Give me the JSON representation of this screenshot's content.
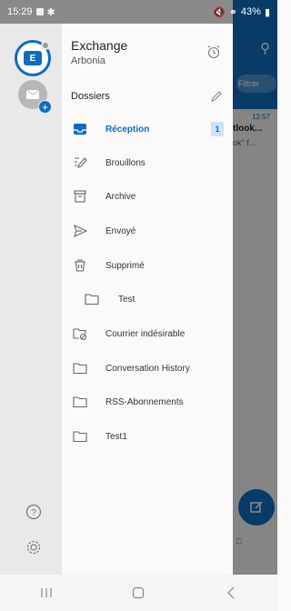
{
  "status_bar": {
    "time": "15:29",
    "battery": "43%"
  },
  "account": {
    "name": "Exchange",
    "org": "Arbonia"
  },
  "folders_title": "Dossiers",
  "folders": [
    {
      "label": "Réception",
      "icon": "inbox-icon",
      "count": "1",
      "active": true
    },
    {
      "label": "Brouillons",
      "icon": "drafts-icon"
    },
    {
      "label": "Archive",
      "icon": "archive-icon"
    },
    {
      "label": "Envoyé",
      "icon": "sent-icon"
    },
    {
      "label": "Supprimé",
      "icon": "trash-icon"
    },
    {
      "label": "Test",
      "icon": "folder-icon",
      "sub": true
    },
    {
      "label": "Courrier indésirable",
      "icon": "junk-icon"
    },
    {
      "label": "Conversation History",
      "icon": "folder-icon"
    },
    {
      "label": "RSS-Abonnements",
      "icon": "folder-icon"
    },
    {
      "label": "Test1",
      "icon": "folder-icon"
    }
  ],
  "background": {
    "filter_label": "Filtrer",
    "time": "13:57",
    "title": "tlook...",
    "preview": "ok\" f..."
  },
  "colors": {
    "accent": "#0f6cbd",
    "rail": "#e9e9ea"
  }
}
